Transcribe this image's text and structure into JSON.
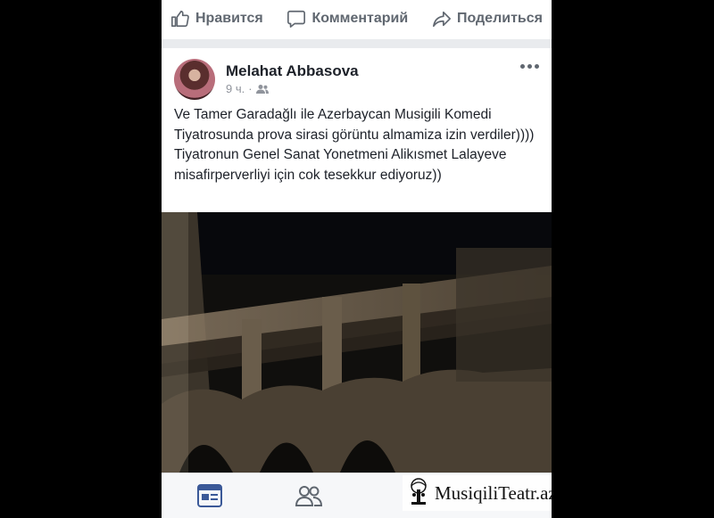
{
  "actions": {
    "like_label": "Нравится",
    "comment_label": "Комментарий",
    "share_label": "Поделиться"
  },
  "post": {
    "author": "Melahat Abbasova",
    "time": "9 ч.",
    "separator": "·",
    "privacy_icon": "friends-icon",
    "text": "Ve Tamer Garadağlı ile Azerbaycan Musigili Komedi Tiyatrosunda prova sirasi görüntu almamiza izin verdiler)))) Tiyatronun Genel Sanat Yonetmeni Alikısmet Lalayeve misafirperverliyi için cok tesekkur ediyoruz))"
  },
  "watermark": {
    "text": "MusiqiliTeatr.az"
  },
  "colors": {
    "icon_blue": "#3b5998",
    "text_dark": "#1d2129",
    "text_muted": "#90949c"
  }
}
